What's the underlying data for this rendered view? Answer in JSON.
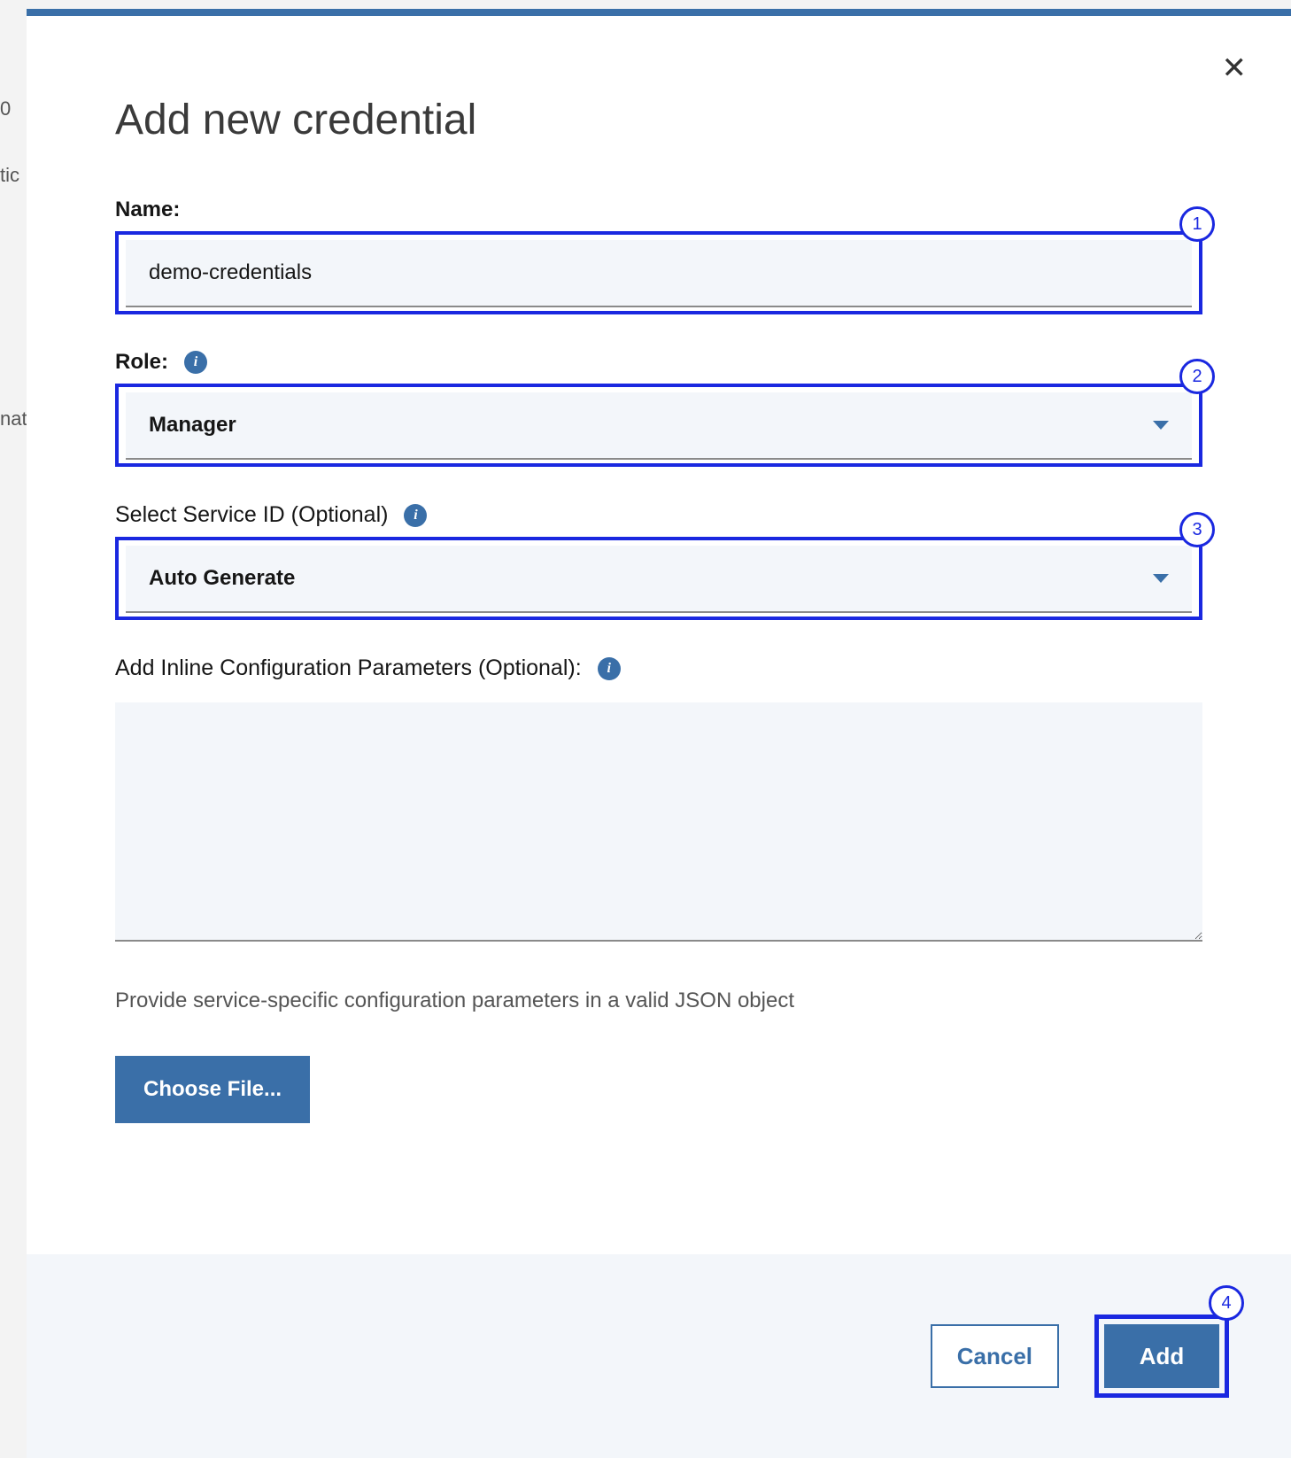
{
  "modal": {
    "title": "Add new credential",
    "callouts": {
      "name": "1",
      "role": "2",
      "service_id": "3",
      "add": "4"
    },
    "name": {
      "label": "Name:",
      "value": "demo-credentials"
    },
    "role": {
      "label": "Role:",
      "value": "Manager"
    },
    "service_id": {
      "label": "Select Service ID (Optional)",
      "value": "Auto Generate"
    },
    "config": {
      "label": "Add Inline Configuration Parameters (Optional):",
      "value": "",
      "help": "Provide service-specific configuration parameters in a valid JSON object",
      "choose_file": "Choose File..."
    },
    "footer": {
      "cancel": "Cancel",
      "add": "Add"
    }
  },
  "background": {
    "frag1": "0",
    "frag2": "tic",
    "frag3": "nat"
  }
}
